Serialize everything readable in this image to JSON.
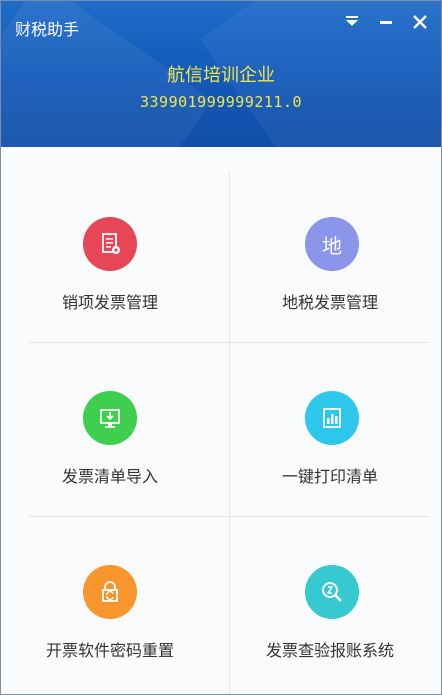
{
  "app": {
    "title": "财税助手",
    "company_name": "航信培训企业",
    "tax_id": "339901999999211.0"
  },
  "window_controls": {
    "menu": "dropdown-menu-icon",
    "minimize": "minimize-icon",
    "close": "close-icon"
  },
  "tiles": [
    {
      "label": "销项发票管理",
      "icon": "invoice-document-icon",
      "color": "#e64656"
    },
    {
      "label": "地税发票管理",
      "icon": "local-tax-icon",
      "icon_text": "地",
      "color": "#8b95ea"
    },
    {
      "label": "发票清单导入",
      "icon": "import-monitor-icon",
      "color": "#3fcf4e"
    },
    {
      "label": "一键打印清单",
      "icon": "print-list-icon",
      "color": "#2cc7ea"
    },
    {
      "label": "开票软件密码重置",
      "icon": "password-lock-icon",
      "color": "#f7962c"
    },
    {
      "label": "发票查验报账系统",
      "icon": "verify-search-icon",
      "color": "#36c9cf"
    }
  ]
}
